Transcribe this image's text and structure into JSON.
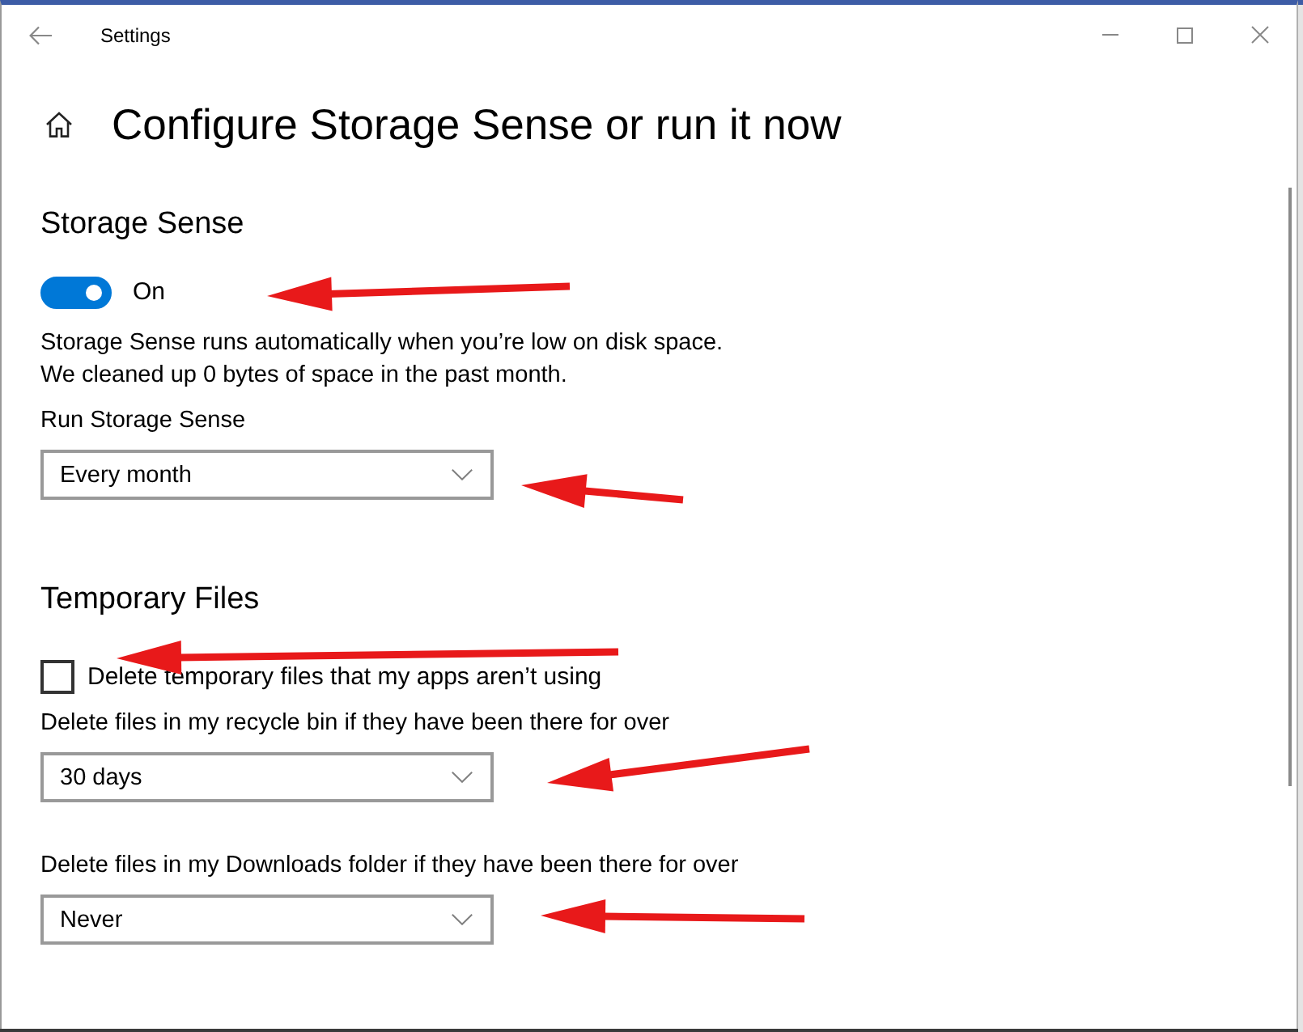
{
  "window": {
    "title": "Settings"
  },
  "page": {
    "title": "Configure Storage Sense or run it now"
  },
  "sections": [
    {
      "title": "Storage Sense",
      "items": [
        {
          "kind": "toggle",
          "on": true,
          "label": "On",
          "annotated": true
        },
        {
          "kind": "text",
          "lines": [
            "Storage Sense runs automatically when you’re low on disk space.",
            "We cleaned up 0 bytes of space in the past month."
          ]
        },
        {
          "kind": "dropdown",
          "label": "Run Storage Sense",
          "value": "Every month",
          "annotated": true
        }
      ]
    },
    {
      "title": "Temporary Files",
      "items": [
        {
          "kind": "checkbox",
          "checked": false,
          "label": "Delete temporary files that my apps aren’t using",
          "annotated": true
        },
        {
          "kind": "dropdown",
          "label": "Delete files in my recycle bin if they have been there for over",
          "value": "30 days",
          "annotated": true
        },
        {
          "kind": "dropdown",
          "label": "Delete files in my Downloads folder if they have been there for over",
          "value": "Never",
          "annotated": true
        }
      ]
    }
  ]
}
